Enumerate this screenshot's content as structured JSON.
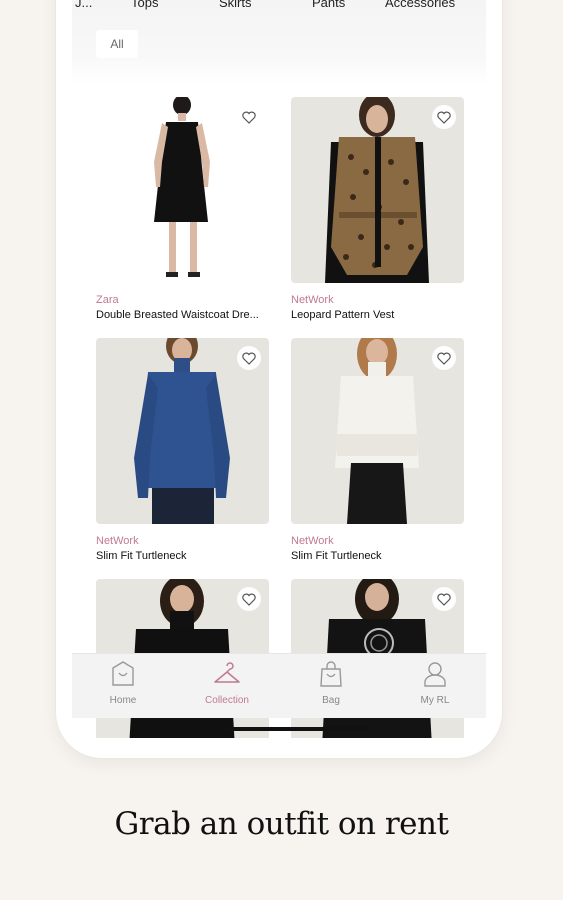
{
  "categories": {
    "tabs": [
      "J...",
      "Tops",
      "Skirts",
      "Pants",
      "Accessories"
    ],
    "chip": "All"
  },
  "products": [
    {
      "brand": "Zara",
      "title": "Double Breasted Waistcoat Dre..."
    },
    {
      "brand": "NetWork",
      "title": "Leopard Pattern Vest"
    },
    {
      "brand": "NetWork",
      "title": "Slim Fit Turtleneck"
    },
    {
      "brand": "NetWork",
      "title": "Slim Fit Turtleneck"
    },
    {
      "brand": "",
      "title": ""
    },
    {
      "brand": "",
      "title": ""
    }
  ],
  "nav": {
    "items": [
      {
        "label": "Home",
        "icon": "home-bag-icon"
      },
      {
        "label": "Collection",
        "icon": "hanger-icon"
      },
      {
        "label": "Bag",
        "icon": "shopping-bag-icon"
      },
      {
        "label": "My RL",
        "icon": "user-icon"
      }
    ],
    "active_index": 1
  },
  "tagline": "Grab an outfit on rent",
  "colors": {
    "accent": "#c07a8f",
    "background": "#f7f4ef"
  }
}
